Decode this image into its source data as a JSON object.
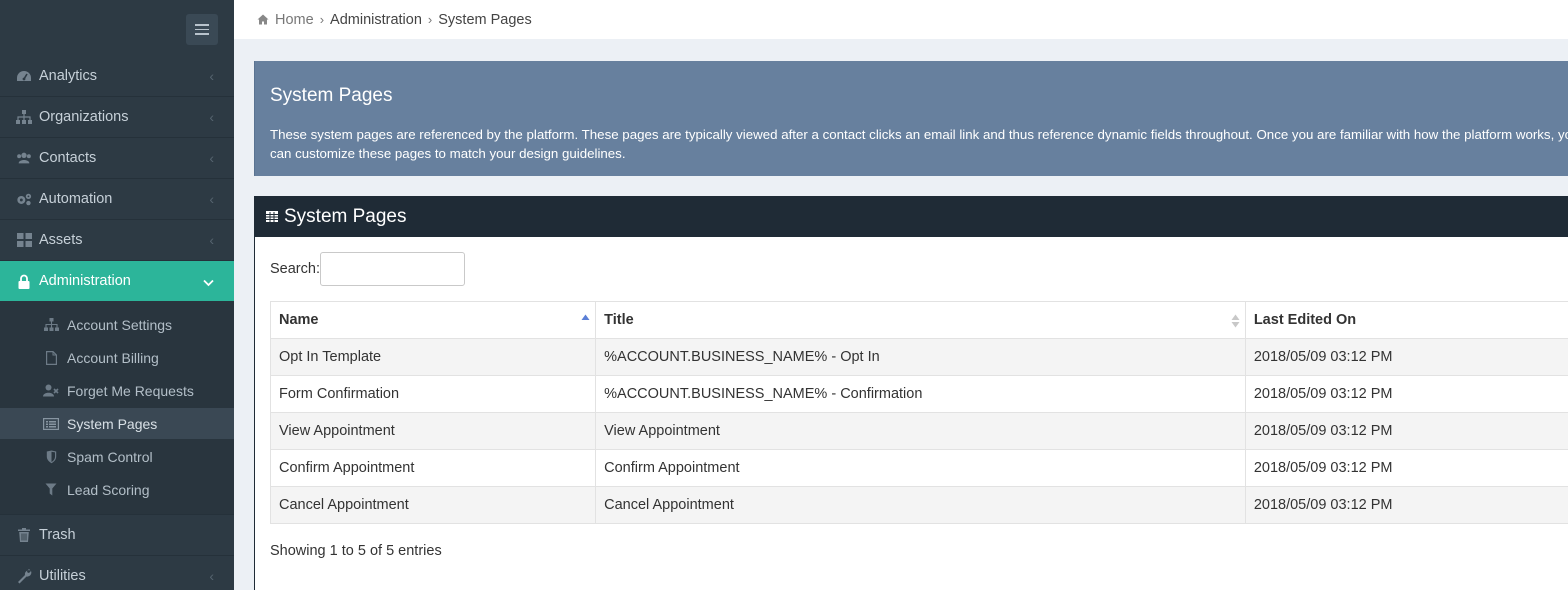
{
  "sidebar": {
    "menu_toggle": "menu-toggle",
    "items": [
      {
        "label": "Analytics",
        "icon": "dashboard-icon"
      },
      {
        "label": "Organizations",
        "icon": "sitemap-icon"
      },
      {
        "label": "Contacts",
        "icon": "users-icon"
      },
      {
        "label": "Automation",
        "icon": "cogs-icon"
      },
      {
        "label": "Assets",
        "icon": "th-large-icon"
      },
      {
        "label": "Administration",
        "icon": "lock-icon",
        "active": true
      },
      {
        "label": "Trash",
        "icon": "trash-icon"
      },
      {
        "label": "Utilities",
        "icon": "wrench-icon"
      }
    ],
    "admin_submenu": [
      {
        "label": "Account Settings",
        "icon": "sitemap-icon"
      },
      {
        "label": "Account Billing",
        "icon": "file-icon"
      },
      {
        "label": "Forget Me Requests",
        "icon": "user-times-icon"
      },
      {
        "label": "System Pages",
        "icon": "list-alt-icon",
        "active": true
      },
      {
        "label": "Spam Control",
        "icon": "shield-icon"
      },
      {
        "label": "Lead Scoring",
        "icon": "filter-icon"
      }
    ]
  },
  "breadcrumb": {
    "home": "Home",
    "separator": "›",
    "items": [
      "Administration",
      "System Pages"
    ]
  },
  "info_panel": {
    "title": "System Pages",
    "text": "These system pages are referenced by the platform. These pages are typically viewed after a contact clicks an email link and thus reference dynamic fields throughout. Once you are familiar with how the platform works, you can customize these pages to match your design guidelines."
  },
  "box": {
    "title": "System Pages",
    "search_label": "Search:",
    "search_value": "",
    "columns": [
      "Name",
      "Title",
      "Last Edited On"
    ],
    "sorted_column": "Name",
    "sort_direction": "ascending",
    "rows": [
      {
        "name": "Opt In Template",
        "title": "%ACCOUNT.BUSINESS_NAME% - Opt In",
        "edited": "2018/05/09 03:12 PM"
      },
      {
        "name": "Form Confirmation",
        "title": "%ACCOUNT.BUSINESS_NAME% - Confirmation",
        "edited": "2018/05/09 03:12 PM"
      },
      {
        "name": "View Appointment",
        "title": "View Appointment",
        "edited": "2018/05/09 03:12 PM"
      },
      {
        "name": "Confirm Appointment",
        "title": "Confirm Appointment",
        "edited": "2018/05/09 03:12 PM"
      },
      {
        "name": "Cancel Appointment",
        "title": "Cancel Appointment",
        "edited": "2018/05/09 03:12 PM"
      }
    ],
    "entries_info": "Showing 1 to 5 of 5 entries"
  },
  "colors": {
    "sidebar_bg": "#2d3a44",
    "active_accent": "#2cb59a",
    "info_bg": "#67809e",
    "box_header_bg": "#1f2b36",
    "sort_active": "#5b7fd6"
  }
}
